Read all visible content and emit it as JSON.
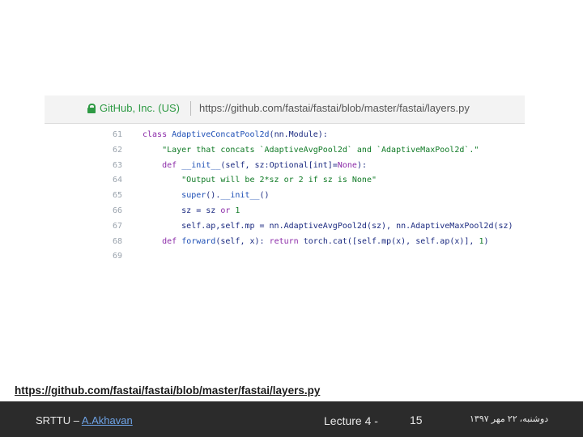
{
  "screenshot": {
    "secure_label": "GitHub, Inc. (US)",
    "url": "https://github.com/fastai/fastai/blob/master/fastai/layers.py",
    "code_lines": [
      {
        "num": "61",
        "tokens": [
          {
            "t": "class ",
            "c": "kw"
          },
          {
            "t": "AdaptiveConcatPool2d",
            "c": "fn"
          },
          {
            "t": "(nn.Module):",
            "c": ""
          }
        ]
      },
      {
        "num": "62",
        "tokens": [
          {
            "t": "    \"Layer that concats `AdaptiveAvgPool2d` and `AdaptiveMaxPool2d`.\"",
            "c": "str"
          }
        ]
      },
      {
        "num": "63",
        "tokens": [
          {
            "t": "    ",
            "c": ""
          },
          {
            "t": "def ",
            "c": "kw"
          },
          {
            "t": "__init__",
            "c": "fn"
          },
          {
            "t": "(self, sz:Optional[int]=",
            "c": ""
          },
          {
            "t": "None",
            "c": "kw"
          },
          {
            "t": "):",
            "c": ""
          }
        ]
      },
      {
        "num": "64",
        "tokens": [
          {
            "t": "        \"Output will be 2*sz or 2 if sz is None\"",
            "c": "str"
          }
        ]
      },
      {
        "num": "65",
        "tokens": [
          {
            "t": "        ",
            "c": ""
          },
          {
            "t": "super",
            "c": "fn"
          },
          {
            "t": "().",
            "c": ""
          },
          {
            "t": "__init__",
            "c": "fn"
          },
          {
            "t": "()",
            "c": ""
          }
        ]
      },
      {
        "num": "66",
        "tokens": [
          {
            "t": "        sz = sz ",
            "c": ""
          },
          {
            "t": "or ",
            "c": "kw"
          },
          {
            "t": "1",
            "c": "num"
          }
        ]
      },
      {
        "num": "67",
        "tokens": [
          {
            "t": "        self.ap,self.mp = nn.AdaptiveAvgPool2d(sz), nn.AdaptiveMaxPool2d(sz)",
            "c": ""
          }
        ]
      },
      {
        "num": "68",
        "tokens": [
          {
            "t": "    ",
            "c": ""
          },
          {
            "t": "def ",
            "c": "kw"
          },
          {
            "t": "forward",
            "c": "fn"
          },
          {
            "t": "(self, x): ",
            "c": ""
          },
          {
            "t": "return ",
            "c": "kw"
          },
          {
            "t": "torch.cat([self.mp(x), self.ap(x)], ",
            "c": ""
          },
          {
            "t": "1",
            "c": "num"
          },
          {
            "t": ")",
            "c": ""
          }
        ]
      },
      {
        "num": "69",
        "tokens": []
      }
    ]
  },
  "source_link": "https://github.com/fastai/fastai/blob/master/fastai/layers.py",
  "footer": {
    "institution": "SRTTU – ",
    "author": "A.Akhavan",
    "lecture": "Lecture 4 -",
    "page": "15",
    "date": "دوشنبه، ٢٢ مهر ١٣٩٧"
  },
  "colors": {
    "footer_bg": "#2b2b2b",
    "secure_green": "#2e9a44",
    "author_link": "#6ea3e6"
  }
}
